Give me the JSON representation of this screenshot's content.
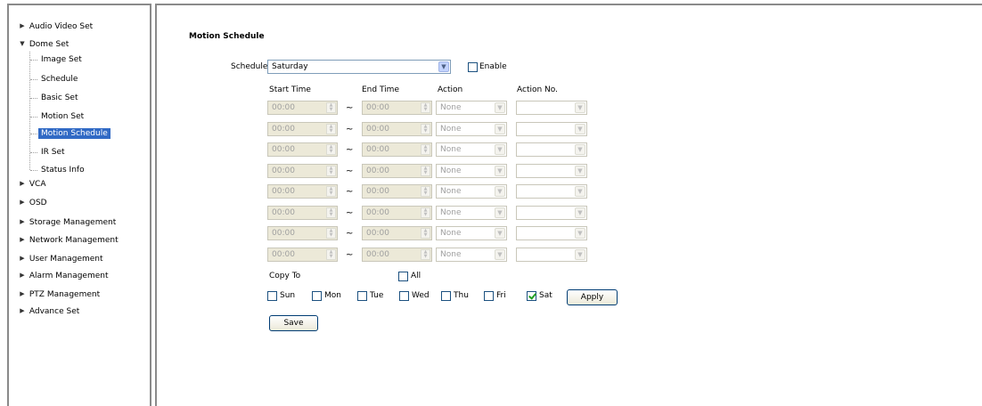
{
  "sidebar": {
    "items": [
      {
        "label": "Audio Video Set",
        "expanded": false
      },
      {
        "label": "Dome Set",
        "expanded": true
      },
      {
        "label": "VCA",
        "expanded": false
      },
      {
        "label": "OSD",
        "expanded": false
      },
      {
        "label": "Storage Management",
        "expanded": false
      },
      {
        "label": "Network Management",
        "expanded": false
      },
      {
        "label": "User Management",
        "expanded": false
      },
      {
        "label": "Alarm Management",
        "expanded": false
      },
      {
        "label": "PTZ Management",
        "expanded": false
      },
      {
        "label": "Advance Set",
        "expanded": false
      }
    ],
    "dome_children": [
      {
        "label": "Image Set"
      },
      {
        "label": "Schedule"
      },
      {
        "label": "Basic Set"
      },
      {
        "label": "Motion Set"
      },
      {
        "label": "Motion Schedule",
        "selected": true
      },
      {
        "label": "IR Set"
      },
      {
        "label": "Status Info"
      }
    ],
    "arrow_collapsed": "▶",
    "arrow_expanded": "▼"
  },
  "main": {
    "title": "Motion Schedule",
    "schedule_label": "Schedule",
    "schedule_value": "Saturday",
    "enable_label": "Enable",
    "enable_checked": false,
    "columns": [
      "Start Time",
      "End Time",
      "Action",
      "Action No."
    ],
    "tilde": "~",
    "rows": [
      {
        "start": "00:00",
        "end": "00:00",
        "action": "None",
        "action_no": ""
      },
      {
        "start": "00:00",
        "end": "00:00",
        "action": "None",
        "action_no": ""
      },
      {
        "start": "00:00",
        "end": "00:00",
        "action": "None",
        "action_no": ""
      },
      {
        "start": "00:00",
        "end": "00:00",
        "action": "None",
        "action_no": ""
      },
      {
        "start": "00:00",
        "end": "00:00",
        "action": "None",
        "action_no": ""
      },
      {
        "start": "00:00",
        "end": "00:00",
        "action": "None",
        "action_no": ""
      },
      {
        "start": "00:00",
        "end": "00:00",
        "action": "None",
        "action_no": ""
      },
      {
        "start": "00:00",
        "end": "00:00",
        "action": "None",
        "action_no": ""
      }
    ],
    "copy_to_label": "Copy To",
    "all_label": "All",
    "all_checked": false,
    "days": [
      {
        "label": "Sun",
        "checked": false
      },
      {
        "label": "Mon",
        "checked": false
      },
      {
        "label": "Tue",
        "checked": false
      },
      {
        "label": "Wed",
        "checked": false
      },
      {
        "label": "Thu",
        "checked": false
      },
      {
        "label": "Fri",
        "checked": false
      },
      {
        "label": "Sat",
        "checked": true
      }
    ],
    "apply_label": "Apply",
    "save_label": "Save"
  },
  "icons": {
    "dropdown": "▼",
    "spin": "▲▼"
  },
  "colors": {
    "selection": "#316ac5",
    "frame_border": "#8a8a8a",
    "disabled_bg": "#ece9d8"
  }
}
